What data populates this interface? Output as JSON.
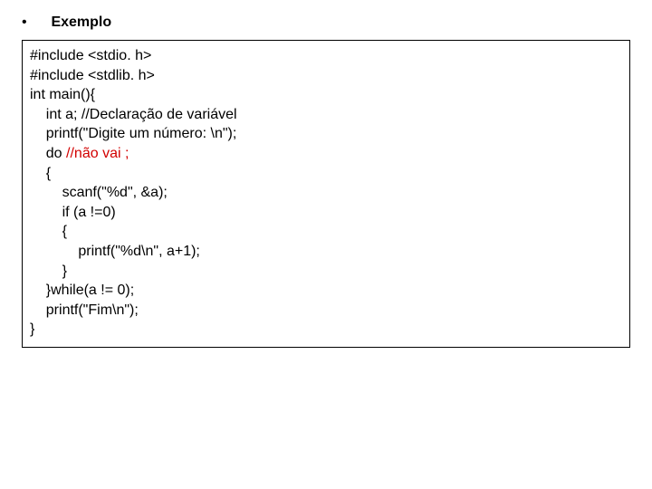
{
  "heading": {
    "bullet": "•",
    "text": "Exemplo"
  },
  "code": {
    "l01": "#include <stdio. h>",
    "l02": "#include <stdlib. h>",
    "l03": "",
    "l04": "int main(){",
    "l05": "    int a; //Declaração de variável",
    "l06": "",
    "l07": "    printf(\"Digite um número: \\n\");",
    "l08a": "    do ",
    "l08b": "//não vai ;",
    "l09": "    {",
    "l10": "        scanf(\"%d\", &a);",
    "l11": "        if (a !=0)",
    "l12": "        {",
    "l13": "            printf(\"%d\\n\", a+1);",
    "l14": "        }",
    "l15": "    }while(a != 0);",
    "l16": "    printf(\"Fim\\n\");",
    "l17": "}"
  }
}
